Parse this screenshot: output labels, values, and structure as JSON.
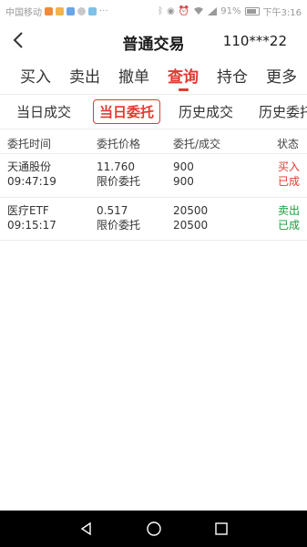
{
  "status_bar": {
    "carrier": "中国移动",
    "battery": "91%",
    "time": "下午3:16",
    "dots": "···"
  },
  "header": {
    "title": "普通交易",
    "account": "110***22"
  },
  "main_tabs": [
    {
      "label": "买入"
    },
    {
      "label": "卖出"
    },
    {
      "label": "撤单"
    },
    {
      "label": "查询"
    },
    {
      "label": "持仓"
    },
    {
      "label": "更多"
    }
  ],
  "sub_tabs": [
    {
      "label": "当日成交"
    },
    {
      "label": "当日委托"
    },
    {
      "label": "历史成交"
    },
    {
      "label": "历史委托"
    }
  ],
  "table": {
    "columns": [
      "委托时间",
      "委托价格",
      "委托/成交",
      "状态"
    ],
    "rows": [
      {
        "name": "天通股份",
        "time": "09:47:19",
        "price": "11.760",
        "price_type": "限价委托",
        "order_qty": "900",
        "filled_qty": "900",
        "side": "买入",
        "status": "已成"
      },
      {
        "name": "医疗ETF",
        "time": "09:15:17",
        "price": "0.517",
        "price_type": "限价委托",
        "order_qty": "20500",
        "filled_qty": "20500",
        "side": "卖出",
        "status": "已成"
      }
    ]
  },
  "colors": {
    "accent": "#e23a2e",
    "buy": "#e23a2e",
    "sell": "#1a9b3a"
  }
}
